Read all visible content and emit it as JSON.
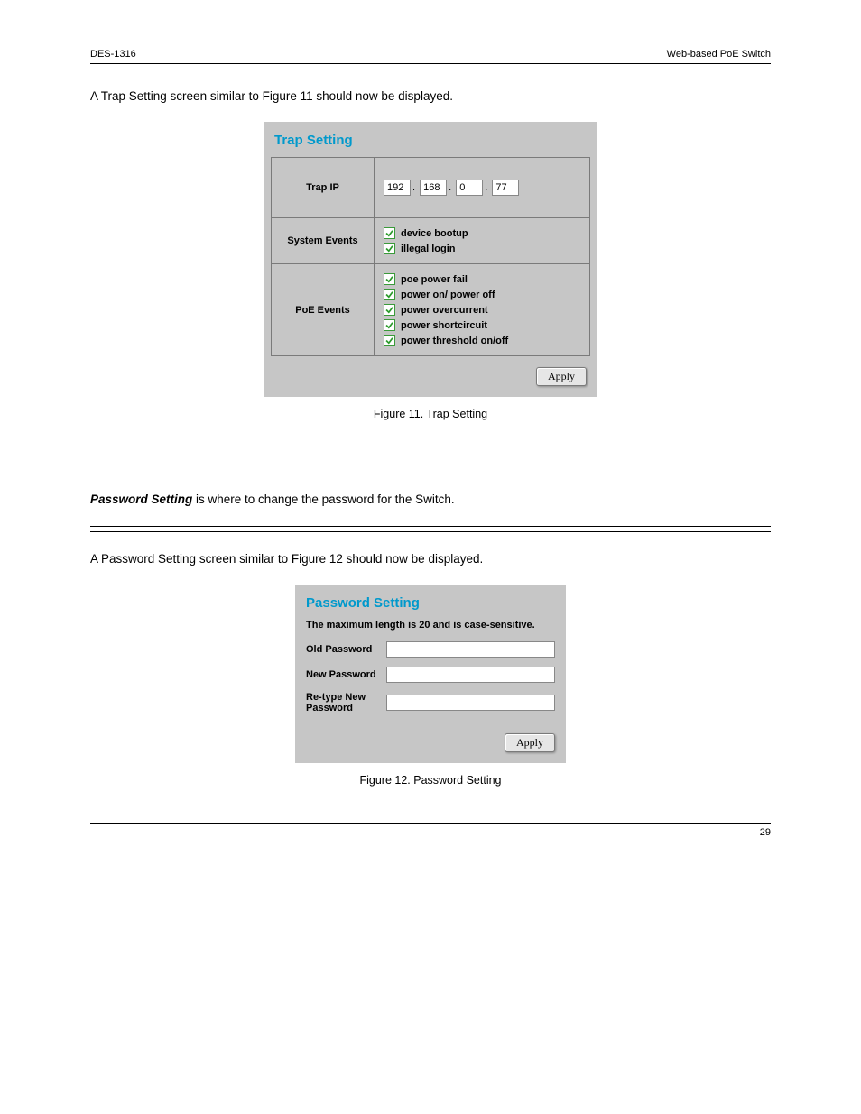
{
  "header": {
    "left": "DES-1316",
    "right": "Web-based PoE Switch"
  },
  "footer": {
    "right": "29"
  },
  "trap_intro": "A Trap Setting screen similar to Figure 11 should now be displayed.",
  "trap_panel": {
    "title": "Trap Setting",
    "rows": {
      "trap_ip": {
        "label": "Trap IP",
        "octets": [
          "192",
          "168",
          "0",
          "77"
        ]
      },
      "system_events": {
        "label": "System Events",
        "items": [
          "device bootup",
          "illegal login"
        ]
      },
      "poe_events": {
        "label": "PoE Events",
        "items": [
          "poe power fail",
          "power on/ power off",
          "power overcurrent",
          "power shortcircuit",
          "power threshold on/off"
        ]
      }
    },
    "apply_label": "Apply",
    "caption": "Figure 11. Trap Setting"
  },
  "pw_header": {
    "intro1": "Password Setting",
    "intro1_rest": " is where to change the password for the Switch.",
    "intro2": "A Password Setting screen similar to Figure 12 should now be displayed."
  },
  "pw_panel": {
    "title": "Password Setting",
    "hint": "The maximum length is 20 and is case-sensitive.",
    "labels": {
      "old": "Old Password",
      "new": "New Password",
      "re": "Re-type New Password"
    },
    "apply_label": "Apply",
    "caption": "Figure 12. Password Setting"
  }
}
